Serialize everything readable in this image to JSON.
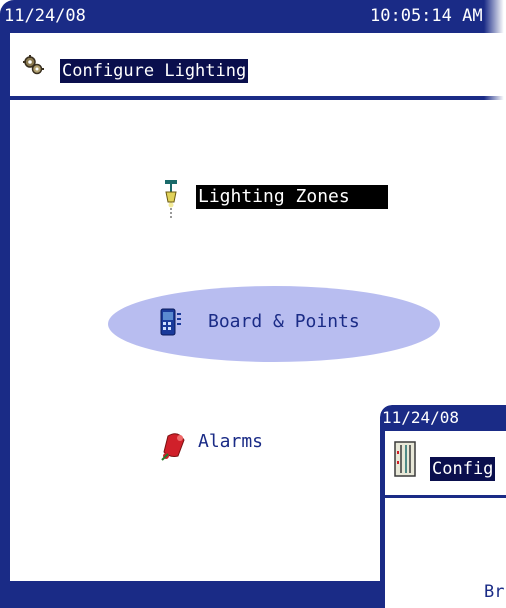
{
  "status_bar": {
    "date": "11/24/08",
    "time": "10:05:14 AM"
  },
  "header": {
    "title": "Configure Lighting",
    "icon": "gears-icon"
  },
  "menu": {
    "items": [
      {
        "label": "Lighting Zones",
        "icon": "lamp-icon",
        "selected": false
      },
      {
        "label": "Board & Points",
        "icon": "board-icon",
        "selected": true
      },
      {
        "label": "Alarms",
        "icon": "alarm-bell-icon",
        "selected": false
      }
    ]
  },
  "overlay_screen": {
    "date": "11/24/08",
    "title": "Config",
    "text": "Br",
    "icon": "panel-icon"
  },
  "colors": {
    "frame": "#1a2b86",
    "title_bg": "#0a0f4d",
    "selection": "#b8bdf0",
    "text": "#1a2b86"
  }
}
